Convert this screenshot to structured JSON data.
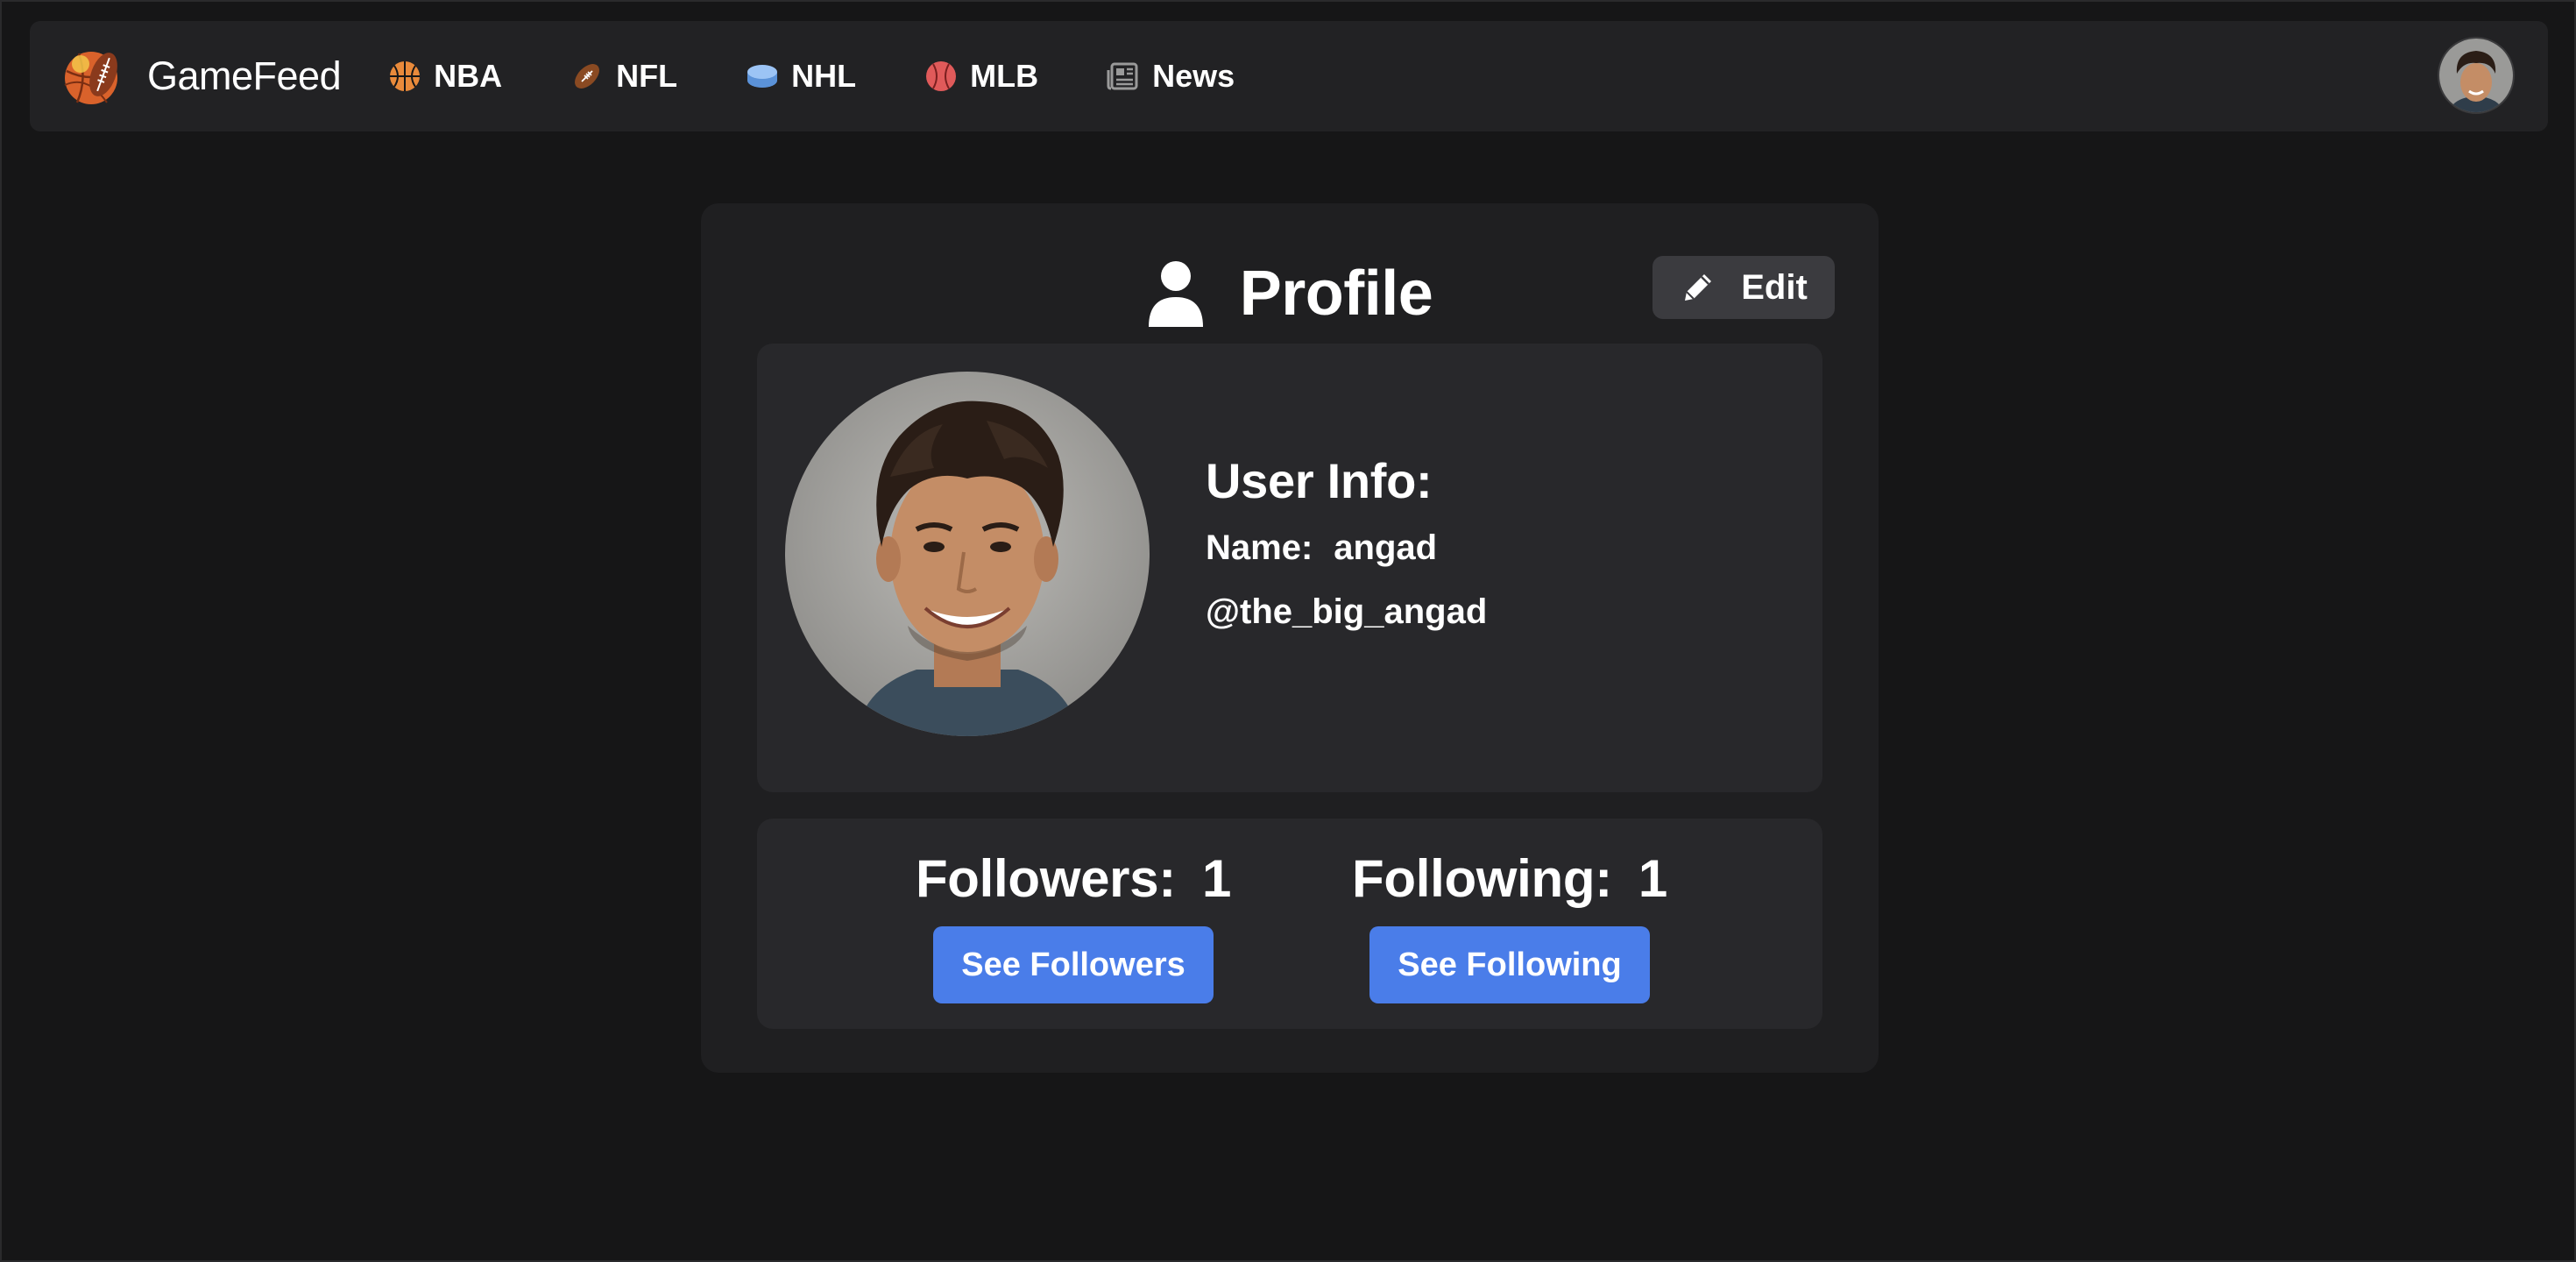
{
  "navbar": {
    "brand": {
      "name": "GameFeed",
      "logo_icon": "sports-balls-logo-icon"
    },
    "items": [
      {
        "label": "NBA",
        "icon": "basketball-icon",
        "color": "#e98a3b"
      },
      {
        "label": "NFL",
        "icon": "football-icon",
        "color": "#8a4a22"
      },
      {
        "label": "NHL",
        "icon": "hockey-puck-icon",
        "color": "#7fb2f0"
      },
      {
        "label": "MLB",
        "icon": "baseball-icon",
        "color": "#e05a5a"
      },
      {
        "label": "News",
        "icon": "newspaper-icon",
        "color": "#9a9a9a"
      }
    ],
    "avatar_icon": "user-avatar"
  },
  "profile": {
    "title": "Profile",
    "title_icon": "user-icon",
    "edit_label": "Edit",
    "edit_icon": "pencil-icon",
    "user_info": {
      "heading": "User Info:",
      "name_label": "Name:",
      "name_value": "angad",
      "handle": "@the_big_angad"
    },
    "followers": {
      "label": "Followers:",
      "count": "1",
      "button_label": "See Followers"
    },
    "following": {
      "label": "Following:",
      "count": "1",
      "button_label": "See Following"
    }
  },
  "colors": {
    "background": "#161617",
    "navbar": "#222224",
    "card": "#1f1f21",
    "panel": "#28282b",
    "accent_button": "#4a7de9",
    "edit_button": "#3b3b3f"
  }
}
